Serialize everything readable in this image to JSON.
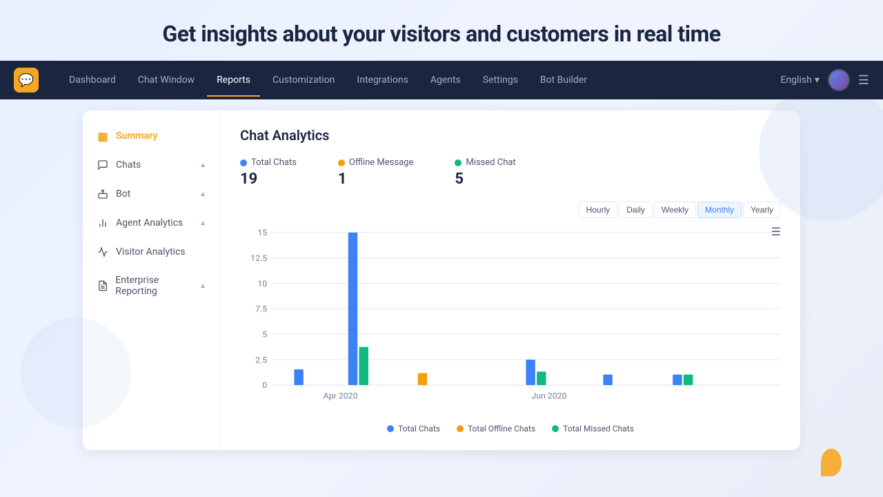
{
  "hero": {
    "text": "Get insights about your visitors and customers in real time"
  },
  "navbar": {
    "logo_icon": "💬",
    "links": [
      {
        "label": "Dashboard",
        "active": false
      },
      {
        "label": "Chat Window",
        "active": false
      },
      {
        "label": "Reports",
        "active": true
      },
      {
        "label": "Customization",
        "active": false
      },
      {
        "label": "Integrations",
        "active": false
      },
      {
        "label": "Agents",
        "active": false
      },
      {
        "label": "Settings",
        "active": false
      },
      {
        "label": "Bot Builder",
        "active": false
      }
    ],
    "language": "English",
    "menu_icon": "☰"
  },
  "sidebar": {
    "items": [
      {
        "label": "Summary",
        "icon": "▦",
        "active": true,
        "hasChevron": false
      },
      {
        "label": "Chats",
        "icon": "💬",
        "active": false,
        "hasChevron": true
      },
      {
        "label": "Bot",
        "icon": "🤖",
        "active": false,
        "hasChevron": true
      },
      {
        "label": "Agent Analytics",
        "icon": "📊",
        "active": false,
        "hasChevron": true
      },
      {
        "label": "Visitor Analytics",
        "icon": "📈",
        "active": false,
        "hasChevron": false
      },
      {
        "label": "Enterprise Reporting",
        "icon": "📄",
        "active": false,
        "hasChevron": true
      }
    ]
  },
  "content": {
    "title": "Chat Analytics",
    "stats": [
      {
        "label": "Total Chats",
        "value": "19",
        "color": "blue"
      },
      {
        "label": "Offline Message",
        "value": "1",
        "color": "orange"
      },
      {
        "label": "Missed Chat",
        "value": "5",
        "color": "green"
      }
    ],
    "time_filters": [
      {
        "label": "Hourly",
        "active": false
      },
      {
        "label": "Daily",
        "active": false
      },
      {
        "label": "Weekly",
        "active": false
      },
      {
        "label": "Monthly",
        "active": true
      },
      {
        "label": "Yearly",
        "active": false
      }
    ],
    "chart": {
      "y_labels": [
        "15",
        "12.5",
        "10",
        "7.5",
        "5",
        "2.5",
        "0"
      ],
      "x_labels": [
        "Apr 2020",
        "Jun 2020"
      ],
      "legend": [
        {
          "label": "Total Chats",
          "color": "#3b82f6"
        },
        {
          "label": "Total Offline Chats",
          "color": "#f59e0b"
        },
        {
          "label": "Total Missed Chats",
          "color": "#10b981"
        }
      ]
    }
  }
}
